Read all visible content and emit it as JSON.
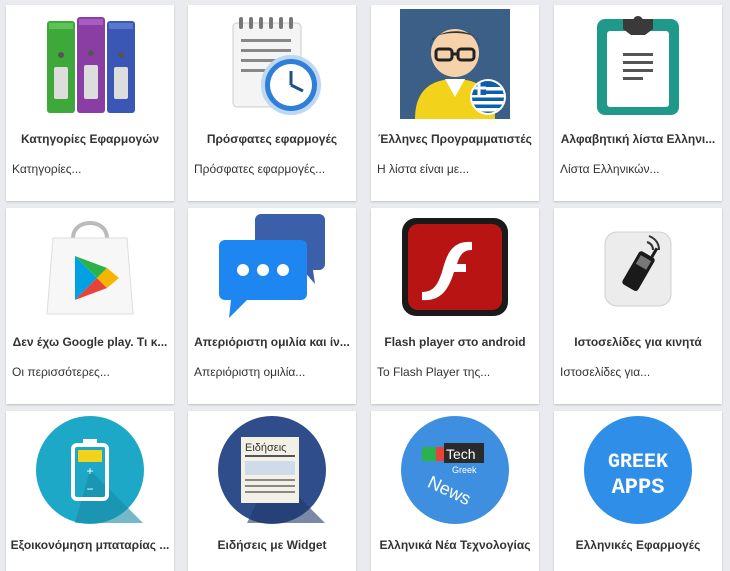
{
  "apps": [
    {
      "title": "Κατηγορίες Εφαρμογών",
      "desc": "Κατηγορίες...",
      "icon": "folders-icon"
    },
    {
      "title": "Πρόσφατες εφαρμογές",
      "desc": "Πρόσφατες εφαρμογές...",
      "icon": "notepad-clock-icon"
    },
    {
      "title": "Έλληνες Προγραμματιστές",
      "desc": "Η λίστα είναι με...",
      "icon": "programmer-greek-flag-icon"
    },
    {
      "title": "Αλφαβητική λίστα Ελληνι...",
      "desc": "Λίστα Ελληνικών...",
      "icon": "clipboard-icon"
    },
    {
      "title": "Δεν έχω Google play. Τι κ...",
      "desc": "Οι περισσότερες...",
      "icon": "google-play-bag-icon"
    },
    {
      "title": "Απεριόριστη ομιλία και ίν...",
      "desc": "Απεριόριστη ομιλία...",
      "icon": "chat-bubbles-icon"
    },
    {
      "title": "Flash player στο android",
      "desc": "Το Flash Player της...",
      "icon": "flash-player-icon"
    },
    {
      "title": "Ιστοσελίδες για κινητά",
      "desc": "Ιστοσελίδες για...",
      "icon": "mobile-phone-icon"
    },
    {
      "title": "Εξοικονόμηση μπαταρίας ...",
      "desc": "",
      "icon": "battery-icon"
    },
    {
      "title": "Ειδήσεις με Widget",
      "desc": "",
      "icon": "newspaper-icon",
      "icon_text": "Ειδήσεις"
    },
    {
      "title": "Ελληνικά Νέα Τεχνολογίας",
      "desc": "",
      "icon": "tech-news-icon",
      "icon_text": [
        "Tech",
        "Greek",
        "News"
      ]
    },
    {
      "title": "Ελληνικές Εφαρμογές",
      "desc": "",
      "icon": "greek-apps-icon",
      "icon_text": [
        "GREEK",
        "APPS"
      ]
    }
  ]
}
